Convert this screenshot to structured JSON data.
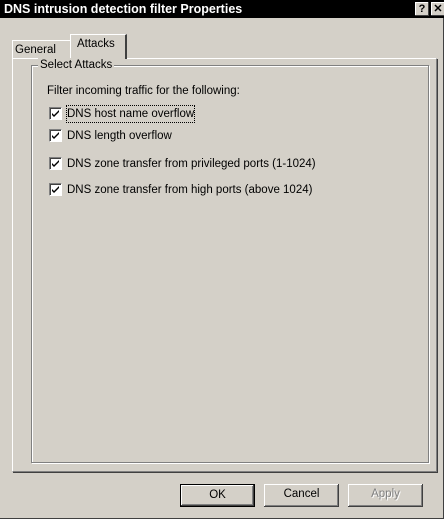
{
  "window": {
    "title": "DNS intrusion detection filter Properties",
    "help_glyph": "?",
    "close_glyph": "✕"
  },
  "tabs": [
    {
      "label": "General",
      "active": false
    },
    {
      "label": "Attacks",
      "active": true
    }
  ],
  "group": {
    "label": "Select Attacks",
    "instruction": "Filter incoming traffic for the following:",
    "items": [
      {
        "label": "DNS host name overflow",
        "checked": true
      },
      {
        "label": "DNS length overflow",
        "checked": true
      },
      {
        "label": "DNS zone transfer from privileged ports (1-1024)",
        "checked": true
      },
      {
        "label": "DNS zone transfer from high ports (above 1024)",
        "checked": true
      }
    ]
  },
  "buttons": {
    "ok": "OK",
    "cancel": "Cancel",
    "apply": "Apply"
  },
  "colors": {
    "face": "#d4d0c8",
    "titlebar": "#000000",
    "disabled_text": "#808080"
  }
}
